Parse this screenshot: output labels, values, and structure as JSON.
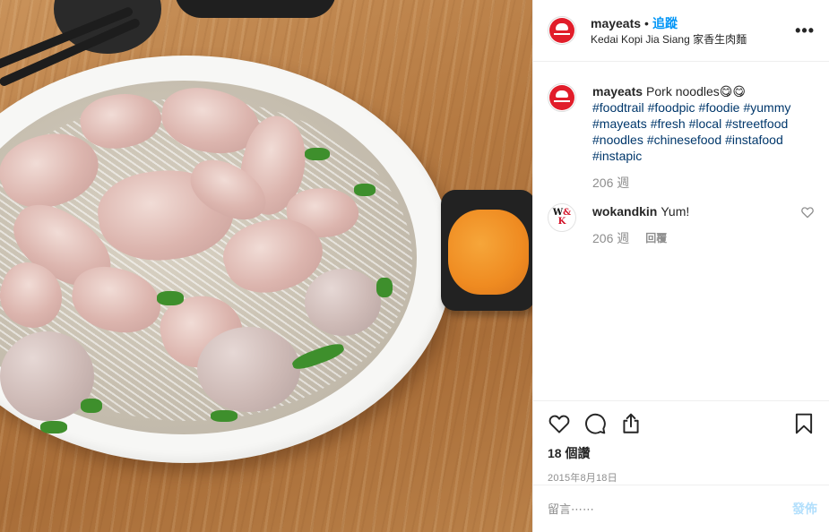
{
  "header": {
    "username": "mayeats",
    "separator": "•",
    "follow_label": "追蹤",
    "location": "Kedai Kopi Jia Siang 家香生肉麵",
    "more_label": "•••"
  },
  "caption": {
    "username": "mayeats",
    "text": "Pork noodles😋😋",
    "hashtags": [
      "#foodtrail",
      "#foodpic",
      "#foodie",
      "#yummy",
      "#mayeats",
      "#fresh",
      "#local",
      "#streetfood",
      "#noodles",
      "#chinesefood",
      "#instafood",
      "#instapic"
    ],
    "age": "206 週"
  },
  "comments": [
    {
      "username": "wokandkin",
      "avatar_text_top": "W",
      "avatar_text_amp": "&",
      "avatar_text_bottom": "K",
      "text": "Yum!",
      "age": "206 週",
      "reply_label": "回覆"
    }
  ],
  "actions": {
    "likes_label": "18 個讚",
    "date": "2015年8月18日"
  },
  "add_comment": {
    "placeholder": "留言⋯⋯",
    "post_label": "發佈"
  },
  "icons": [
    "heart-icon",
    "comment-icon",
    "share-icon",
    "bookmark-icon",
    "more-icon"
  ],
  "colors": {
    "link_blue": "#0095f6",
    "hashtag_blue": "#00376b",
    "muted_gray": "#8e8e8e",
    "post_disabled": "#b2dffc",
    "avatar_red": "#e11d2a"
  }
}
